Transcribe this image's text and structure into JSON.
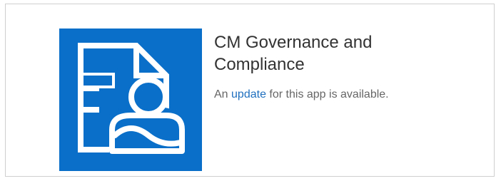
{
  "app": {
    "title": "CM Governance and Compliance",
    "icon": "document-person-icon",
    "tile_color": "#0a6fc8",
    "update_notice": {
      "prefix": "An",
      "link_text": "update",
      "suffix": "for this app is available."
    }
  },
  "colors": {
    "link": "#1f6fbf",
    "title_text": "#333333",
    "status_text": "#666666",
    "card_border": "#cfcfcf"
  }
}
